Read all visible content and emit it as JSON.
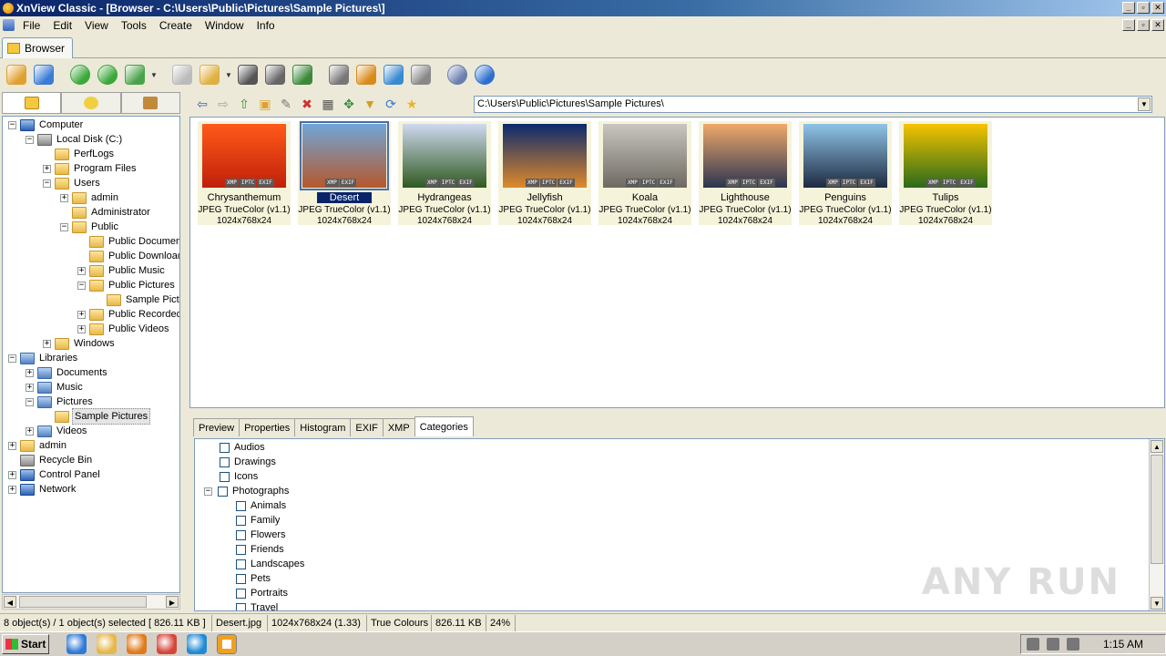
{
  "window": {
    "title": "XnView Classic - [Browser - C:\\Users\\Public\\Pictures\\Sample Pictures\\]",
    "buttons": [
      "_",
      "▫",
      "✕"
    ]
  },
  "menu": [
    "File",
    "Edit",
    "View",
    "Tools",
    "Create",
    "Window",
    "Info"
  ],
  "tab": {
    "label": "Browser"
  },
  "toolbar": {
    "icons": [
      {
        "name": "open-browser-icon",
        "color": "#e0a030"
      },
      {
        "name": "fullscreen-icon",
        "color": "#3a7bd5"
      },
      {
        "name": "refresh-icon",
        "color": "#3aa83a"
      },
      {
        "name": "reload-icon",
        "color": "#3aa83a"
      },
      {
        "name": "set-folder-icon",
        "color": "#4aa34a"
      },
      {
        "name": "file-icon",
        "color": "#bbbbbb"
      },
      {
        "name": "copy-to-icon",
        "color": "#e0b040"
      },
      {
        "name": "find-icon",
        "color": "#555555"
      },
      {
        "name": "print-icon",
        "color": "#666666"
      },
      {
        "name": "slideshow-icon",
        "color": "#3b8a3b"
      },
      {
        "name": "capture-icon",
        "color": "#777777"
      },
      {
        "name": "desktop-icon",
        "color": "#d98b1a"
      },
      {
        "name": "convert-icon",
        "color": "#3a8ad0"
      },
      {
        "name": "calculator-icon",
        "color": "#888888"
      },
      {
        "name": "settings-icon",
        "color": "#6a7fb0"
      },
      {
        "name": "info-icon",
        "color": "#2d6fcf"
      }
    ]
  },
  "nav": {
    "path": "C:\\Users\\Public\\Pictures\\Sample Pictures\\"
  },
  "tree": [
    {
      "label": "Computer",
      "level": 0,
      "exp": "−",
      "icon": "comp"
    },
    {
      "label": "Local Disk (C:)",
      "level": 1,
      "exp": "−",
      "icon": "drive"
    },
    {
      "label": "PerfLogs",
      "level": 2,
      "exp": "",
      "icon": "folder"
    },
    {
      "label": "Program Files",
      "level": 2,
      "exp": "+",
      "icon": "folder"
    },
    {
      "label": "Users",
      "level": 2,
      "exp": "−",
      "icon": "folder"
    },
    {
      "label": "admin",
      "level": 3,
      "exp": "+",
      "icon": "folder"
    },
    {
      "label": "Administrator",
      "level": 3,
      "exp": "",
      "icon": "folder"
    },
    {
      "label": "Public",
      "level": 3,
      "exp": "−",
      "icon": "folder"
    },
    {
      "label": "Public Documents",
      "level": 4,
      "exp": "",
      "icon": "folder"
    },
    {
      "label": "Public Downloads",
      "level": 4,
      "exp": "",
      "icon": "folder"
    },
    {
      "label": "Public Music",
      "level": 4,
      "exp": "+",
      "icon": "folder"
    },
    {
      "label": "Public Pictures",
      "level": 4,
      "exp": "−",
      "icon": "folder"
    },
    {
      "label": "Sample Pictures",
      "level": 5,
      "exp": "",
      "icon": "folder"
    },
    {
      "label": "Public Recorded TV",
      "level": 4,
      "exp": "+",
      "icon": "folder"
    },
    {
      "label": "Public Videos",
      "level": 4,
      "exp": "+",
      "icon": "folder"
    },
    {
      "label": "Windows",
      "level": 2,
      "exp": "+",
      "icon": "folder"
    },
    {
      "label": "Libraries",
      "level": 0,
      "exp": "−",
      "icon": "lib"
    },
    {
      "label": "Documents",
      "level": 1,
      "exp": "+",
      "icon": "lib"
    },
    {
      "label": "Music",
      "level": 1,
      "exp": "+",
      "icon": "lib"
    },
    {
      "label": "Pictures",
      "level": 1,
      "exp": "−",
      "icon": "lib"
    },
    {
      "label": "Sample Pictures",
      "level": 2,
      "exp": "",
      "icon": "folder",
      "selected": true
    },
    {
      "label": "Videos",
      "level": 1,
      "exp": "+",
      "icon": "lib"
    },
    {
      "label": "admin",
      "level": 0,
      "exp": "+",
      "icon": "folder"
    },
    {
      "label": "Recycle Bin",
      "level": 0,
      "exp": "",
      "icon": "drive"
    },
    {
      "label": "Control Panel",
      "level": 0,
      "exp": "+",
      "icon": "comp"
    },
    {
      "label": "Network",
      "level": 0,
      "exp": "+",
      "icon": "comp"
    }
  ],
  "thumbnails": [
    {
      "name": "Chrysanthemum",
      "format": "JPEG TrueColor (v1.1)",
      "dims": "1024x768x24",
      "colors": [
        "#ff5a1a",
        "#c0200a"
      ],
      "badges": [
        "XMP",
        "IPTC",
        "EXIF"
      ]
    },
    {
      "name": "Desert",
      "format": "JPEG TrueColor (v1.1)",
      "dims": "1024x768x24",
      "colors": [
        "#6fa6d9",
        "#b5582b"
      ],
      "badges": [
        "XMP",
        "EXIF"
      ],
      "selected": true
    },
    {
      "name": "Hydrangeas",
      "format": "JPEG TrueColor (v1.1)",
      "dims": "1024x768x24",
      "colors": [
        "#cfd9f0",
        "#2f5a1f"
      ],
      "badges": [
        "XMP",
        "IPTC",
        "EXIF"
      ]
    },
    {
      "name": "Jellyfish",
      "format": "JPEG TrueColor (v1.1)",
      "dims": "1024x768x24",
      "colors": [
        "#0a2a6e",
        "#e08a2a"
      ],
      "badges": [
        "XMP",
        "IPTC",
        "EXIF"
      ]
    },
    {
      "name": "Koala",
      "format": "JPEG TrueColor (v1.1)",
      "dims": "1024x768x24",
      "colors": [
        "#c9c6c0",
        "#6e6a62"
      ],
      "badges": [
        "XMP",
        "IPTC",
        "EXIF"
      ]
    },
    {
      "name": "Lighthouse",
      "format": "JPEG TrueColor (v1.1)",
      "dims": "1024x768x24",
      "colors": [
        "#f0a96a",
        "#2a3550"
      ],
      "badges": [
        "XMP",
        "IPTC",
        "EXIF"
      ]
    },
    {
      "name": "Penguins",
      "format": "JPEG TrueColor (v1.1)",
      "dims": "1024x768x24",
      "colors": [
        "#8fc4e8",
        "#1e2a40"
      ],
      "badges": [
        "XMP",
        "IPTC",
        "EXIF"
      ]
    },
    {
      "name": "Tulips",
      "format": "JPEG TrueColor (v1.1)",
      "dims": "1024x768x24",
      "colors": [
        "#f5c400",
        "#2a6a1a"
      ],
      "badges": [
        "XMP",
        "IPTC",
        "EXIF"
      ]
    }
  ],
  "bottom_tabs": [
    "Preview",
    "Properties",
    "Histogram",
    "EXIF",
    "XMP",
    "Categories"
  ],
  "bottom_active": "Categories",
  "categories": [
    {
      "label": "Audios",
      "level": 0,
      "exp": ""
    },
    {
      "label": "Drawings",
      "level": 0,
      "exp": ""
    },
    {
      "label": "Icons",
      "level": 0,
      "exp": ""
    },
    {
      "label": "Photographs",
      "level": 0,
      "exp": "−"
    },
    {
      "label": "Animals",
      "level": 1,
      "exp": ""
    },
    {
      "label": "Family",
      "level": 1,
      "exp": ""
    },
    {
      "label": "Flowers",
      "level": 1,
      "exp": ""
    },
    {
      "label": "Friends",
      "level": 1,
      "exp": ""
    },
    {
      "label": "Landscapes",
      "level": 1,
      "exp": ""
    },
    {
      "label": "Pets",
      "level": 1,
      "exp": ""
    },
    {
      "label": "Portraits",
      "level": 1,
      "exp": ""
    },
    {
      "label": "Travel",
      "level": 1,
      "exp": ""
    }
  ],
  "watermark": "ANY RUN",
  "status": {
    "objects": "8 object(s) / 1 object(s) selected  [ 826.11 KB ]",
    "filename": "Desert.jpg",
    "dims": "1024x768x24 (1.33)",
    "colours": "True Colours",
    "size": "826.11 KB",
    "zoom": "24%"
  },
  "taskbar": {
    "start": "Start",
    "clock": "1:15 AM",
    "apps": [
      {
        "name": "ie-icon",
        "color": "#2f7ad6"
      },
      {
        "name": "explorer-icon",
        "color": "#e6b84a"
      },
      {
        "name": "media-player-icon",
        "color": "#e07b1a"
      },
      {
        "name": "chrome-icon",
        "color": "#d6453a"
      },
      {
        "name": "edge-icon",
        "color": "#1f8ad6"
      },
      {
        "name": "xnview-icon",
        "color": "#f0a020",
        "active": true
      }
    ]
  }
}
